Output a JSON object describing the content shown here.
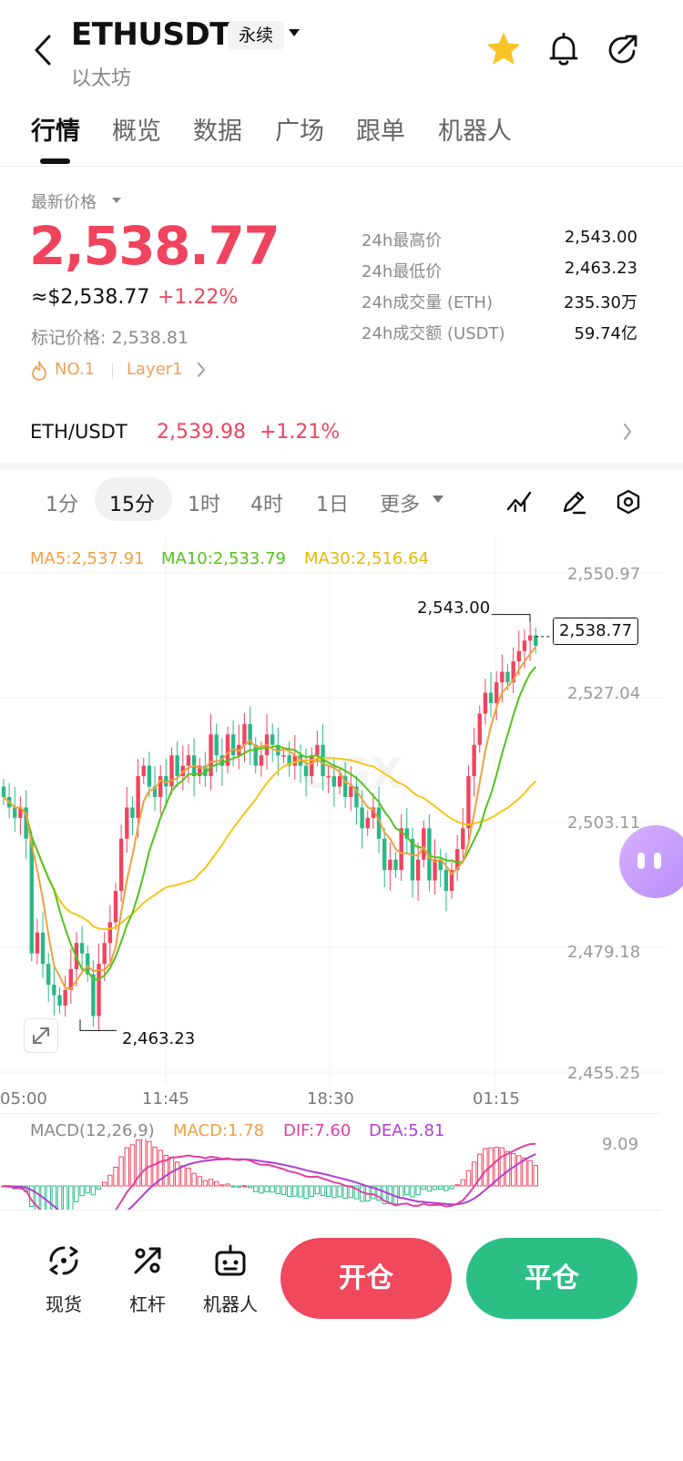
{
  "header": {
    "symbol": "ETHUSDT",
    "contract_type": "永续",
    "name": "以太坊"
  },
  "tabs": [
    {
      "label": "行情",
      "active": true
    },
    {
      "label": "概览"
    },
    {
      "label": "数据"
    },
    {
      "label": "广场"
    },
    {
      "label": "跟单"
    },
    {
      "label": "机器人"
    }
  ],
  "price_block": {
    "label": "最新价格",
    "last_price": "2,538.77",
    "usd_equiv": "≈$2,538.77",
    "change_pct": "+1.22%",
    "mark_price": "标记价格: 2,538.81",
    "rank_tag": "NO.1",
    "category_tag": "Layer1"
  },
  "stats": [
    {
      "label": "24h最高价",
      "value": "2,543.00"
    },
    {
      "label": "24h最低价",
      "value": "2,463.23"
    },
    {
      "label": "24h成交量 (ETH)",
      "value": "235.30万"
    },
    {
      "label": "24h成交额 (USDT)",
      "value": "59.74亿"
    }
  ],
  "pair": {
    "name": "ETH/USDT",
    "price": "2,539.98",
    "change_pct": "+1.21%"
  },
  "intervals": [
    "1分",
    "15分",
    "1时",
    "4时",
    "1日",
    "更多"
  ],
  "selected_interval": "15分",
  "ma_legend": {
    "ma5": "MA5:2,537.91",
    "ma10": "MA10:2,533.79",
    "ma30": "MA30:2,516.64"
  },
  "y_axis": [
    "2,550.97",
    "2,527.04",
    "2,503.11",
    "2,479.18",
    "2,455.25"
  ],
  "time_axis": [
    "05:00",
    "11:45",
    "18:30",
    "01:15"
  ],
  "high_marker": "2,543.00",
  "low_marker": "2,463.23",
  "current_price_tag": "2,538.77",
  "macd_legend": {
    "title": "MACD(12,26,9)",
    "macd": "MACD:1.78",
    "dif": "DIF:7.60",
    "dea": "DEA:5.81",
    "axis_max": "9.09"
  },
  "actions": [
    {
      "label": "现货",
      "icon": "spot-icon"
    },
    {
      "label": "杠杆",
      "icon": "leverage-icon"
    },
    {
      "label": "机器人",
      "icon": "robot-icon"
    }
  ],
  "buttons": {
    "open": "开仓",
    "close": "平仓"
  },
  "colors": {
    "up": "#f0445e",
    "down": "#29b886",
    "ma5": "#f0a040",
    "ma10": "#52c41a",
    "ma30": "#f5c518",
    "dif": "#e040a0",
    "dea": "#b03fd0"
  },
  "chart_data": {
    "type": "candlestick",
    "ylim": [
      2455.25,
      2550.97
    ],
    "y_ticks": [
      2550.97,
      2527.04,
      2503.11,
      2479.18,
      2455.25
    ],
    "x_ticks": [
      "05:00",
      "11:45",
      "18:30",
      "01:15"
    ],
    "high": 2543.0,
    "low": 2463.23,
    "last": 2538.77,
    "ma": {
      "MA5": 2537.91,
      "MA10": 2533.79,
      "MA30": 2516.64
    },
    "close": [
      2508,
      2506,
      2504,
      2506,
      2500,
      2478,
      2482,
      2476,
      2472,
      2470,
      2468,
      2471,
      2475,
      2480,
      2478,
      2474,
      2466,
      2476,
      2480,
      2484,
      2490,
      2500,
      2506,
      2504,
      2512,
      2514,
      2510,
      2508,
      2512,
      2510,
      2516,
      2512,
      2514,
      2516,
      2512,
      2514,
      2512,
      2520,
      2516,
      2514,
      2520,
      2516,
      2518,
      2522,
      2518,
      2514,
      2516,
      2520,
      2518,
      2516,
      2516,
      2514,
      2516,
      2514,
      2512,
      2516,
      2518,
      2512,
      2512,
      2510,
      2512,
      2508,
      2510,
      2506,
      2502,
      2504,
      2506,
      2500,
      2494,
      2496,
      2494,
      2502,
      2500,
      2492,
      2496,
      2502,
      2492,
      2496,
      2494,
      2490,
      2494,
      2498,
      2502,
      2512,
      2518,
      2524,
      2528,
      2526,
      2530,
      2532,
      2530,
      2534,
      2536,
      2538,
      2539,
      2537
    ],
    "macd": {
      "axis_max": 9.09,
      "MACD": 1.78,
      "DIF": 7.6,
      "DEA": 5.81
    }
  }
}
